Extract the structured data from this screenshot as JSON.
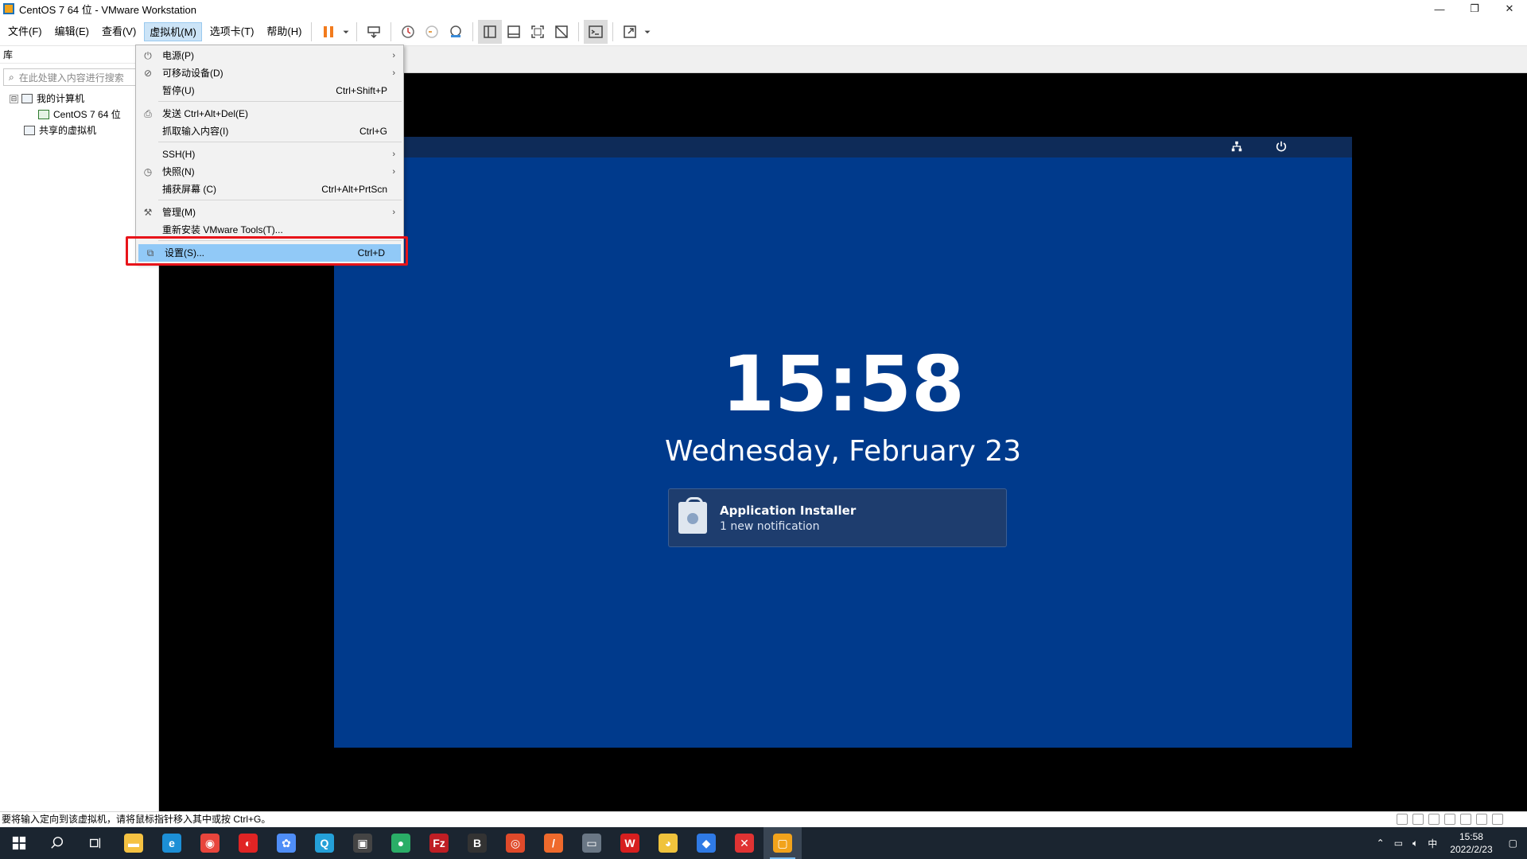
{
  "window": {
    "title": "CentOS 7 64 位 - VMware Workstation",
    "minimize": "—",
    "restore": "❐",
    "close": "✕"
  },
  "menubar": {
    "items": [
      "文件(F)",
      "编辑(E)",
      "查看(V)",
      "虚拟机(M)",
      "选项卡(T)",
      "帮助(H)"
    ],
    "active_index": 3
  },
  "toolbar": {
    "icons": [
      "pause-icon",
      "dropdown-arrow-icon",
      "send-ctrl-alt-del-icon",
      "snapshot-icon",
      "revert-snapshot-icon",
      "snapshot-manager-icon",
      "show-library-icon",
      "show-thumbnail-icon",
      "full-screen-icon",
      "unity-icon",
      "console-view-icon",
      "stretch-view-icon"
    ],
    "accent": "#f27b1d"
  },
  "library": {
    "title": "库",
    "search_placeholder": "在此处键入内容进行搜索",
    "tree": [
      {
        "label": "我的计算机",
        "level": 0,
        "expander": "⊟"
      },
      {
        "label": "CentOS 7 64 位",
        "level": 1
      },
      {
        "label": "共享的虚拟机",
        "level": 0
      }
    ]
  },
  "dropdown": {
    "items": [
      {
        "label": "电源(P)",
        "shortcut": "",
        "submenu": true,
        "icon": "power-icon"
      },
      {
        "label": "可移动设备(D)",
        "shortcut": "",
        "submenu": true,
        "icon": "removable-devices-icon"
      },
      {
        "label": "暂停(U)",
        "shortcut": "Ctrl+Shift+P",
        "submenu": false,
        "icon": ""
      },
      {
        "label": "发送 Ctrl+Alt+Del(E)",
        "shortcut": "",
        "submenu": false,
        "icon": "send-keys-icon"
      },
      {
        "label": "抓取输入内容(I)",
        "shortcut": "Ctrl+G",
        "submenu": false,
        "icon": ""
      },
      {
        "label": "SSH(H)",
        "shortcut": "",
        "submenu": true,
        "icon": ""
      },
      {
        "label": "快照(N)",
        "shortcut": "",
        "submenu": true,
        "icon": "snapshot-icon"
      },
      {
        "label": "捕获屏幕 (C)",
        "shortcut": "Ctrl+Alt+PrtScn",
        "submenu": false,
        "icon": ""
      },
      {
        "label": "管理(M)",
        "shortcut": "",
        "submenu": true,
        "icon": "wrench-icon"
      },
      {
        "label": "重新安装 VMware Tools(T)...",
        "shortcut": "",
        "submenu": false,
        "icon": ""
      },
      {
        "label": "设置(S)...",
        "shortcut": "Ctrl+D",
        "submenu": false,
        "icon": "settings-icon",
        "highlighted": true
      }
    ],
    "highlight_color": "#91c9f7",
    "annotation_color": "#e8141a"
  },
  "guest": {
    "time": "15:58",
    "date": "Wednesday, February 23",
    "notification": {
      "title": "Application Installer",
      "subtitle": "1 new notification"
    },
    "background": "#003a8c"
  },
  "statusbar": {
    "text": "要将输入定向到该虚拟机，请将鼠标指针移入其中或按 Ctrl+G。"
  },
  "taskbar": {
    "apps": [
      {
        "name": "file-explorer-icon",
        "color": "#f5c242",
        "glyph": "▬"
      },
      {
        "name": "edge-icon",
        "color": "#1c8fd6",
        "glyph": "e"
      },
      {
        "name": "chrome-icon",
        "color": "#e8453c",
        "glyph": "◉"
      },
      {
        "name": "app-red-icon",
        "color": "#e02424",
        "glyph": "◐"
      },
      {
        "name": "baidu-netdisk-icon",
        "color": "#4f8ef7",
        "glyph": "✿"
      },
      {
        "name": "app-search-icon",
        "color": "#24a0d8",
        "glyph": "Q"
      },
      {
        "name": "screenshot-app-icon",
        "color": "#444",
        "glyph": "▣"
      },
      {
        "name": "wechat-icon",
        "color": "#2aae67",
        "glyph": "●"
      },
      {
        "name": "filezilla-icon",
        "color": "#bf1e24",
        "glyph": "Fz"
      },
      {
        "name": "app-dark-icon",
        "color": "#333",
        "glyph": "B"
      },
      {
        "name": "app-spiral-icon",
        "color": "#e04a2a",
        "glyph": "◎"
      },
      {
        "name": "postman-icon",
        "color": "#ef6a2c",
        "glyph": "/"
      },
      {
        "name": "remote-desktop-icon",
        "color": "#6a7785",
        "glyph": "▭"
      },
      {
        "name": "wps-icon",
        "color": "#d71f1f",
        "glyph": "W"
      },
      {
        "name": "app-yellow-icon",
        "color": "#f0c33c",
        "glyph": "◕"
      },
      {
        "name": "app-blue-icon",
        "color": "#2f7ae5",
        "glyph": "◆"
      },
      {
        "name": "xmind-icon",
        "color": "#e03333",
        "glyph": "✕"
      },
      {
        "name": "vmware-icon",
        "color": "#f2a31b",
        "glyph": "▢",
        "active": true
      }
    ],
    "tray": {
      "ime": "中",
      "time": "15:58",
      "date": "2022/2/23"
    }
  }
}
